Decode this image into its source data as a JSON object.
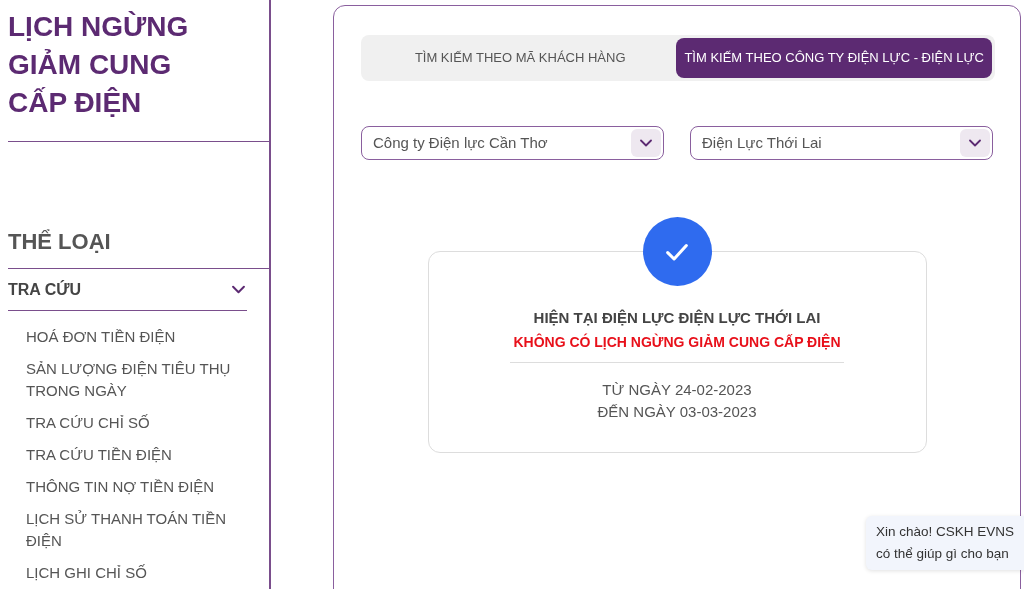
{
  "page_title": "LỊCH NGỪNG GIẢM CUNG CẤP ĐIỆN",
  "sidebar": {
    "heading": "THỂ LOẠI",
    "section": {
      "label": "TRA CỨU",
      "expanded": true
    },
    "items": [
      "HOÁ ĐƠN TIỀN ĐIỆN",
      "SẢN LƯỢNG ĐIỆN TIÊU THỤ TRONG NGÀY",
      "TRA CỨU CHỈ SỐ",
      "TRA CỨU TIỀN ĐIỆN",
      "THÔNG TIN NỢ TIỀN ĐIỆN",
      "LỊCH SỬ THANH TOÁN TIỀN ĐIỆN",
      "LỊCH GHI CHỈ SỐ"
    ]
  },
  "tabs": [
    {
      "label": "TÌM KIẾM THEO MÃ KHÁCH HÀNG",
      "selected": false
    },
    {
      "label": "TÌM KIẾM THEO CÔNG TY ĐIỆN LỰC - ĐIỆN LỰC",
      "selected": true
    }
  ],
  "selects": [
    {
      "value": "Công ty Điện lực Cần Thơ"
    },
    {
      "value": "Điện Lực Thới Lai"
    }
  ],
  "result": {
    "title": "HIỆN TẠI ĐIỆN LỰC ĐIỆN LỰC THỚI LAI",
    "message": "KHÔNG CÓ LỊCH NGỪNG GIẢM CUNG CẤP ĐIỆN",
    "from": "TỪ NGÀY 24-02-2023",
    "to": "ĐẾN NGÀY 03-03-2023"
  },
  "chat_bubble": {
    "lines": [
      "Xin chào! CSKH EVNS",
      "có thể giúp gì cho bạn"
    ]
  }
}
